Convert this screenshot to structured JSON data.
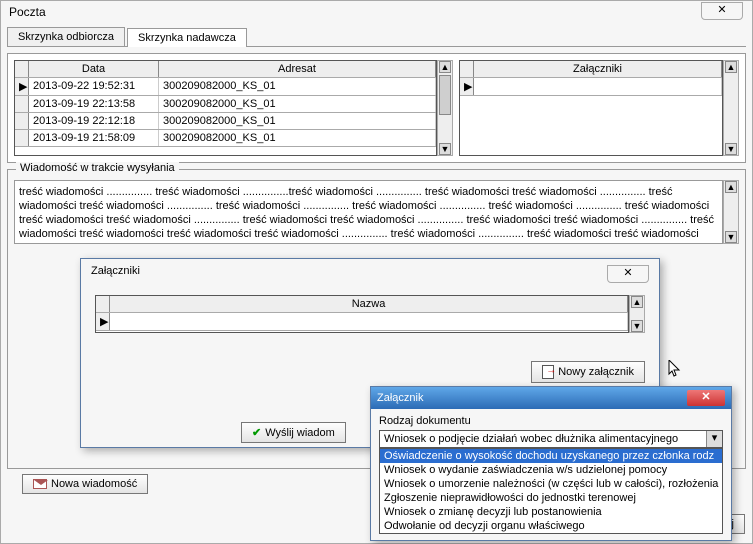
{
  "main": {
    "title": "Poczta",
    "tabs": [
      "Skrzynka odbiorcza",
      "Skrzynka nadawcza"
    ],
    "active_tab": 1,
    "grid_left": {
      "cols": [
        "Data",
        "Adresat"
      ],
      "rows": [
        {
          "date": "2013-09-22 19:52:31",
          "to": "300209082000_KS_01"
        },
        {
          "date": "2013-09-19 22:13:58",
          "to": "300209082000_KS_01"
        },
        {
          "date": "2013-09-19 22:12:18",
          "to": "300209082000_KS_01"
        },
        {
          "date": "2013-09-19 21:58:09",
          "to": "300209082000_KS_01"
        }
      ]
    },
    "grid_right": {
      "cols": [
        "Załączniki"
      ]
    },
    "group_label": "Wiadomość w trakcie wysyłania",
    "body_text": "treść wiadomości ............... treść wiadomości ...............treść wiadomości ............... treść wiadomości treść wiadomości ............... treść wiadomości treść wiadomości ............... treść wiadomości ............... treść wiadomości ............... treść wiadomości ............... treść wiadomości treść wiadomości treść wiadomości ............... treść wiadomości treść wiadomości ............... treść wiadomości treść wiadomości ............... treść wiadomości treść wiadomości treść wiadomości treść wiadomości ............... treść wiadomości ............... treść wiadomości treść wiadomości treść wiadomości ............... treść wiadomości treść wiadomości ............... treść wiadom",
    "btn_new_msg": "Nowa wiadomość",
    "btn_close": "Zamknij"
  },
  "attach_dialog": {
    "title": "Załączniki",
    "grid_col": "Nazwa",
    "btn_new_attach": "Nowy załącznik",
    "btn_send": "Wyślij wiadom"
  },
  "zal_dialog": {
    "title": "Załącznik",
    "label": "Rodzaj dokumentu",
    "selected": "Wniosek o podjęcie działań wobec dłużnika alimentacyjnego",
    "options": [
      "Oświadczenie o wysokość dochodu uzyskanego przez członka rodz",
      "Wniosek o wydanie zaświadczenia w/s udzielonej pomocy",
      "Wniosek o umorzenie należności (w części lub w całości), rozłożenia",
      "Zgłoszenie nieprawidłowości do jednostki terenowej",
      "Wniosek o zmianę decyzji lub postanowienia",
      "Odwołanie od decyzji organu właściwego"
    ],
    "selected_index": 0
  }
}
